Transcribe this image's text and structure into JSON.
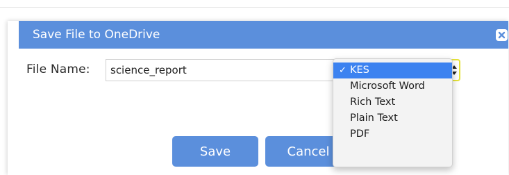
{
  "dialog": {
    "title": "Save File to OneDrive",
    "close_icon": "close-icon"
  },
  "form": {
    "filename_label": "File Name:",
    "filename_value": "science_report",
    "file_type": {
      "selected": "KES",
      "options": [
        "KES",
        "Microsoft Word",
        "Rich Text",
        "Plain Text",
        "PDF"
      ],
      "check_glyph": "✓"
    }
  },
  "buttons": {
    "save_label": "Save",
    "cancel_label": "Cancel"
  },
  "colors": {
    "accent": "#5b8fdc",
    "selection": "#3c82f0",
    "focus_ring": "#e6e33a"
  }
}
